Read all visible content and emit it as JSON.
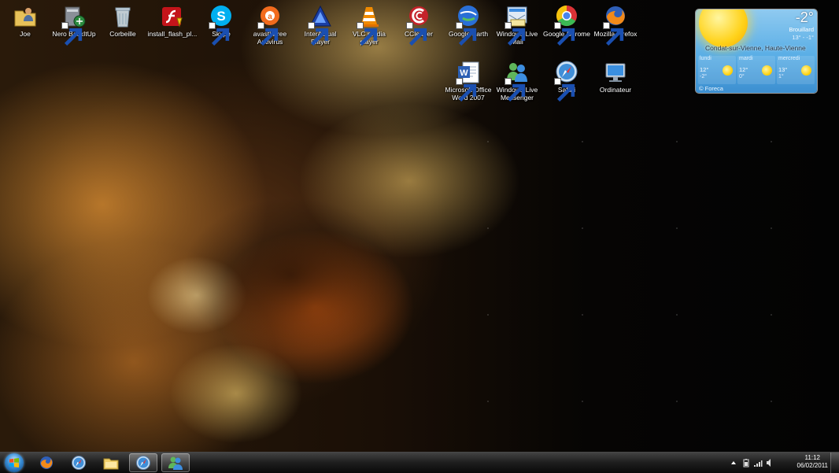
{
  "desktop": {
    "icons": [
      {
        "label": "Joe",
        "icon": "user-folder-icon",
        "shortcut": false
      },
      {
        "label": "Nero BackItUp",
        "icon": "nero-backitup-icon",
        "shortcut": true
      },
      {
        "label": "Corbeille",
        "icon": "recycle-bin-icon",
        "shortcut": false
      },
      {
        "label": "install_flash_pl...",
        "icon": "flash-installer-icon",
        "shortcut": false
      },
      {
        "label": "Skype",
        "icon": "skype-icon",
        "shortcut": true
      },
      {
        "label": "avast! Free Antivirus",
        "icon": "avast-icon",
        "shortcut": true
      },
      {
        "label": "InterActual Player",
        "icon": "interactual-player-icon",
        "shortcut": true
      },
      {
        "label": "VLC media player",
        "icon": "vlc-icon",
        "shortcut": true
      },
      {
        "label": "CCleaner",
        "icon": "ccleaner-icon",
        "shortcut": true
      },
      {
        "label": "Google Earth",
        "icon": "google-earth-icon",
        "shortcut": true
      },
      {
        "label": "Windows Live Mail",
        "icon": "windows-live-mail-icon",
        "shortcut": true
      },
      {
        "label": "Google Chrome",
        "icon": "chrome-icon",
        "shortcut": true
      },
      {
        "label": "Mozilla Firefox",
        "icon": "firefox-icon",
        "shortcut": true
      },
      {
        "label": "Microsoft Office Word 2007",
        "icon": "word-icon",
        "shortcut": true
      },
      {
        "label": "Windows Live Messenger",
        "icon": "messenger-icon",
        "shortcut": true
      },
      {
        "label": "Safari",
        "icon": "safari-icon",
        "shortcut": true
      },
      {
        "label": "Ordinateur",
        "icon": "computer-icon",
        "shortcut": false
      }
    ]
  },
  "weather": {
    "temperature": "-2°",
    "condition": "Brouillard",
    "range": "13° - -1°",
    "location": "Condat-sur-Vienne, Haute-Vienne",
    "forecast": [
      {
        "day": "lundi",
        "high": "12°",
        "low": "-2°",
        "icon": "sun-icon"
      },
      {
        "day": "mardi",
        "high": "12°",
        "low": "0°",
        "icon": "sun-icon"
      },
      {
        "day": "mercredi",
        "high": "13°",
        "low": "1°",
        "icon": "sun-icon"
      }
    ],
    "brand": "© Foreca"
  },
  "taskbar": {
    "start": "start-orb-icon",
    "pinned": [
      {
        "icon": "firefox-icon",
        "active": false
      },
      {
        "icon": "safari-icon",
        "active": false
      },
      {
        "icon": "explorer-folder-icon",
        "active": false
      },
      {
        "icon": "safari-icon",
        "active": true
      },
      {
        "icon": "messenger-icon",
        "active": true
      }
    ],
    "tray": {
      "icons": [
        "show-hidden-icons-chevron",
        "battery-icon",
        "network-signal-icon",
        "volume-icon"
      ],
      "time": "11:12",
      "date": "06/02/2011"
    }
  },
  "colors": {
    "taskbar": "#1e1e1e",
    "weather_sky": "#5aaee6",
    "sun": "#ffd21a"
  }
}
